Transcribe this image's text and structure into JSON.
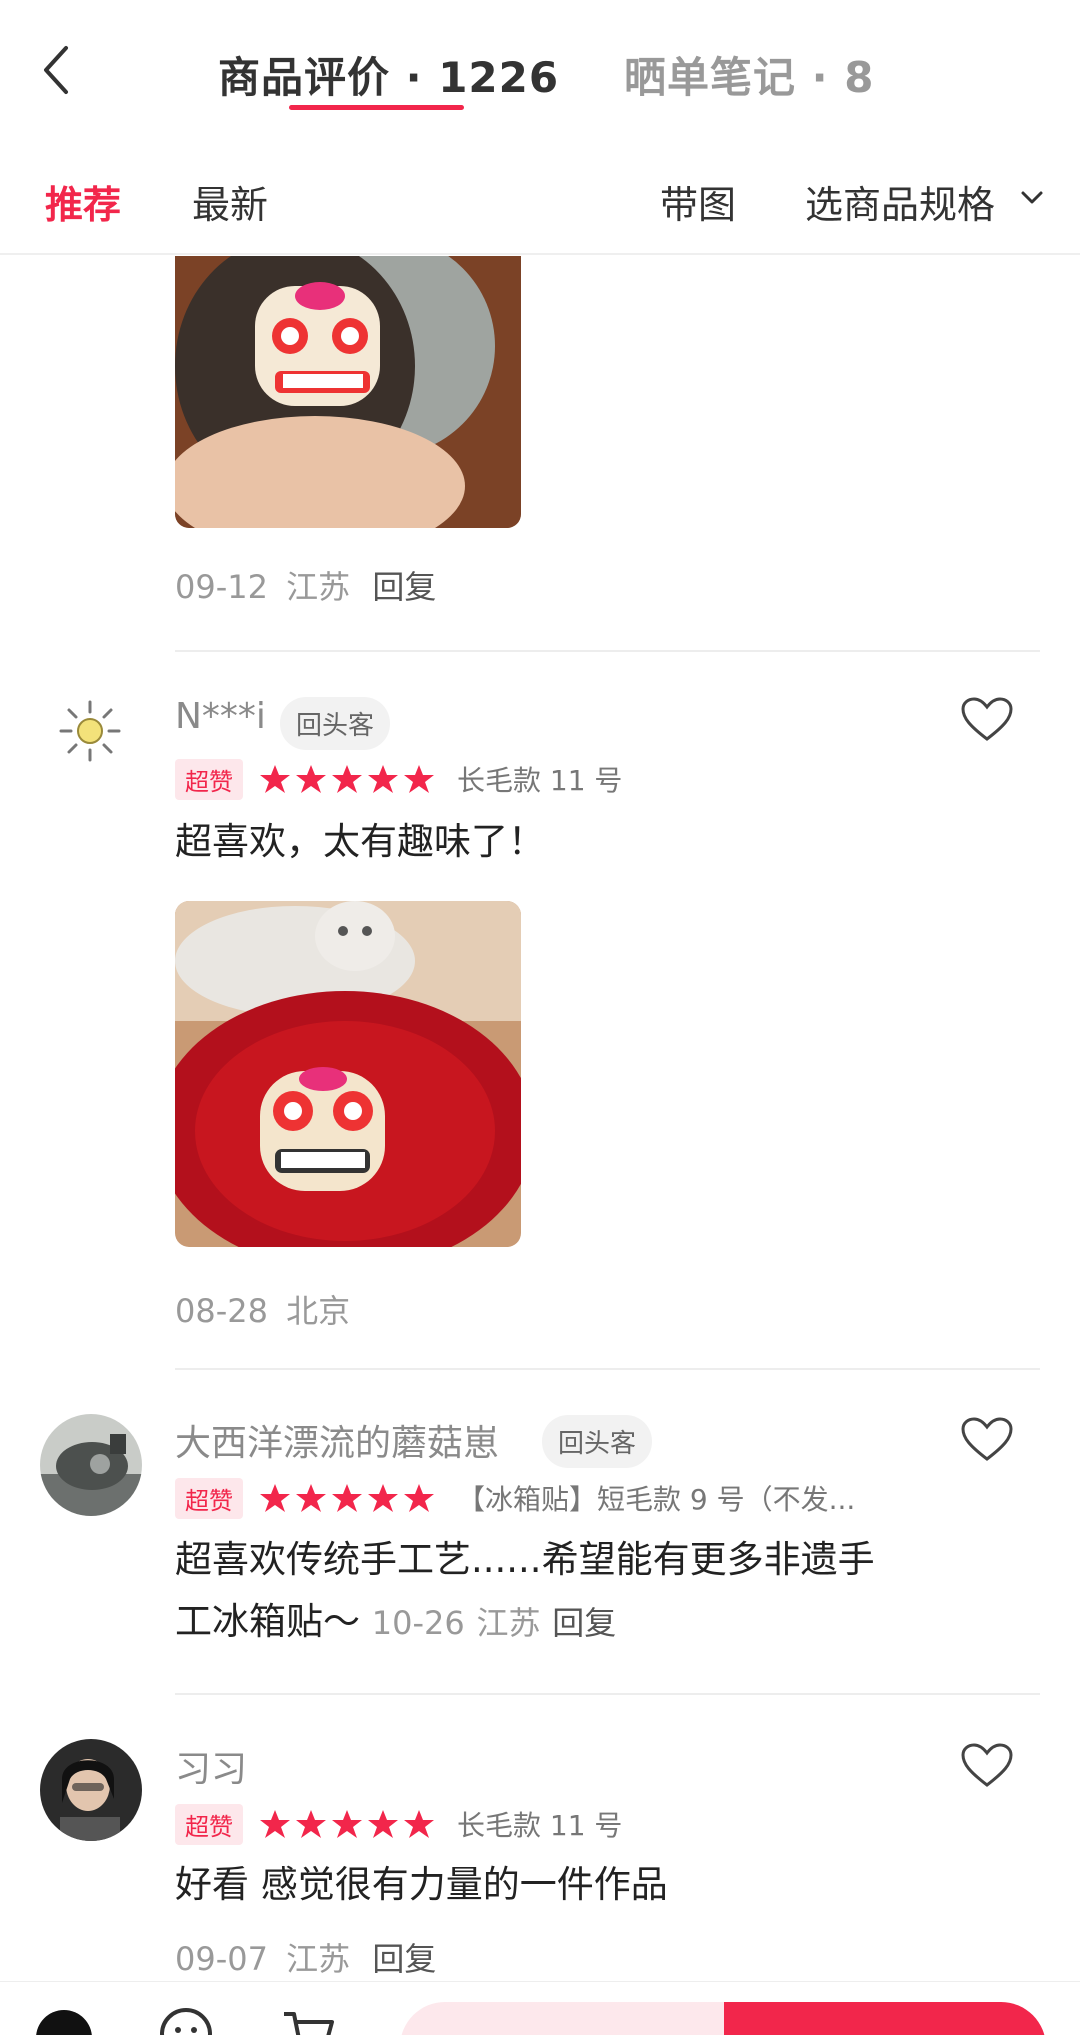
{
  "header": {
    "tab_reviews": "商品评价 · 1226",
    "tab_notes": "晒单笔记 · 8"
  },
  "filters": {
    "recommend": "推荐",
    "latest": "最新",
    "with_images": "带图",
    "select_spec": "选商品规格"
  },
  "reviews": [
    {
      "date": "09-12",
      "location": "江苏",
      "reply": "回复"
    },
    {
      "username": "N***i",
      "badge": "回头客",
      "tag": "超赞",
      "spec": "长毛款 11 号",
      "text": "超喜欢，太有趣味了！",
      "date": "08-28",
      "location": "北京"
    },
    {
      "username": "大西洋漂流的蘑菇崽",
      "badge": "回头客",
      "tag": "超赞",
      "spec": "【冰箱贴】短毛款 9 号（不发...",
      "text": "超喜欢传统手工艺......希望能有更多非遗手工冰箱贴～",
      "date": "10-26",
      "location": "江苏",
      "reply": "回复"
    },
    {
      "username": "习习",
      "tag": "超赞",
      "spec": "长毛款 11 号",
      "text": "好看 感觉很有力量的一件作品",
      "date": "09-07",
      "location": "江苏",
      "reply": "回复"
    }
  ],
  "colors": {
    "accent": "#f2264b",
    "text": "#333333",
    "muted": "#999999"
  }
}
